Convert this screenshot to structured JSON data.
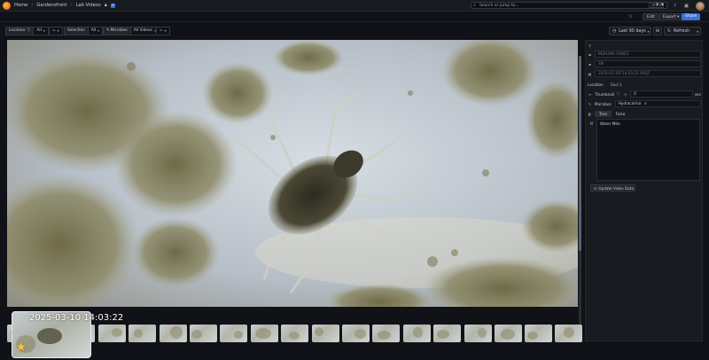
{
  "topbar": {
    "breadcrumbs": [
      "Home",
      "Gardensfront",
      "Lab Videos"
    ],
    "search_placeholder": "Search or jump to...",
    "search_shortcut": "ctrl+k",
    "plus_label": "+ ▾"
  },
  "subbar": {
    "edit_label": "Edit",
    "export_label": "Export ▾",
    "share_label": "Share"
  },
  "variables": {
    "location_label": "Location",
    "location_value": "All",
    "selection_label": "Selection",
    "selection_value": "All",
    "microbes_label": "Microbes",
    "microbes_value": "All Videos"
  },
  "time": {
    "range_label": "Last 90 days",
    "refresh_label": "Refresh"
  },
  "video": {
    "hover_timestamp": "2025-03-10 14:03:22"
  },
  "form": {
    "field1_value": "INZH2N0 5A6D3",
    "field2_value": "SN",
    "field3_value": "2025-03-10T14:03:22.000Z",
    "location_label": "Location",
    "location_value": "Dool 1",
    "thumbnail_label": "Thumbnail",
    "thumbnail_value": "0",
    "thumbnail_unit": "sec",
    "microbes_label": "Microbes",
    "microbes_tag": "Hydracarina",
    "bool_true": "True",
    "bool_false": "False",
    "notes_text": "Water Mite",
    "update_button": "Update Video Data"
  },
  "colors": {
    "accent": "#3d71d9",
    "background": "#111217",
    "panel": "#181b1f"
  }
}
